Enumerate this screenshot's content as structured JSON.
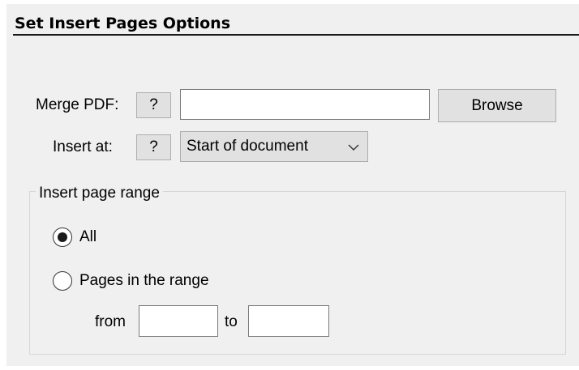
{
  "section": {
    "title": "Set Insert Pages Options"
  },
  "merge_pdf": {
    "label": "Merge PDF:",
    "help_label": "?",
    "value": "",
    "browse_label": "Browse"
  },
  "insert_at": {
    "label": "Insert at:",
    "help_label": "?",
    "selected": "Start of document"
  },
  "page_range": {
    "legend": "Insert page range",
    "options": [
      {
        "label": "All",
        "checked": true
      },
      {
        "label": "Pages in the range",
        "checked": false
      }
    ],
    "from_label": "from",
    "from_value": "",
    "to_label": "to",
    "to_value": ""
  }
}
